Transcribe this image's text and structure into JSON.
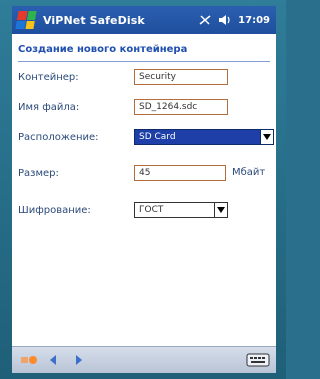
{
  "app": {
    "title": "ViPNet SafeDisk",
    "time": "17:09"
  },
  "dialog": {
    "title": "Создание нового контейнера"
  },
  "form": {
    "container": {
      "label": "Контейнер:",
      "value": "Security"
    },
    "filename": {
      "label": "Имя файла:",
      "value": "SD_1264.sdc"
    },
    "location": {
      "label": "Расположение:",
      "value": "SD Card"
    },
    "size": {
      "label": "Размер:",
      "value": "45",
      "unit": "Мбайт"
    },
    "encryption": {
      "label": "Шифрование:",
      "value": "ГОСТ"
    }
  },
  "icons": {
    "logo": "windows-flag-icon",
    "network": "network-signal-icon",
    "volume": "speaker-volume-icon",
    "keyboard": "keyboard-icon"
  },
  "colors": {
    "titlebar": "#2b5fb0",
    "header_text": "#1e4fb0",
    "field_border": "#b26d3c",
    "selected_field": "#1e3fa8"
  }
}
